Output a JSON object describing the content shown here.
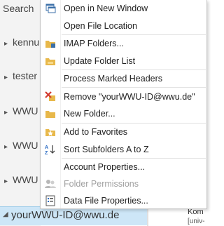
{
  "folder_pane": {
    "items": [
      {
        "label": "Search",
        "expanded": false
      },
      {
        "label": "kennu",
        "expanded": false
      },
      {
        "label": "tester",
        "expanded": false
      },
      {
        "label": "WWU",
        "expanded": false
      },
      {
        "label": "WWU",
        "expanded": false
      },
      {
        "label": "WWU",
        "expanded": false
      }
    ],
    "account": "yourWWU-ID@wwu.de",
    "right_snippet_1": "Kom",
    "right_snippet_2": "[univ-"
  },
  "context_menu": {
    "items": [
      {
        "label": "Open in New Window",
        "icon": "new-window-icon",
        "enabled": true
      },
      {
        "label": "Open File Location",
        "icon": "",
        "enabled": true
      },
      {
        "label": "IMAP Folders...",
        "icon": "imap-folders-icon",
        "enabled": true
      },
      {
        "label": "Update Folder List",
        "icon": "update-folder-list-icon",
        "enabled": true
      },
      {
        "label": "Process Marked Headers",
        "icon": "",
        "enabled": true
      },
      {
        "label": "Remove \"yourWWU-ID@wwu.de\"",
        "icon": "remove-account-icon",
        "enabled": true
      },
      {
        "label": "New Folder...",
        "icon": "new-folder-icon",
        "enabled": true
      },
      {
        "label": "Add to Favorites",
        "icon": "favorites-star-icon",
        "enabled": true
      },
      {
        "label": "Sort Subfolders A to Z",
        "icon": "sort-az-icon",
        "enabled": true
      },
      {
        "label": "Account Properties...",
        "icon": "",
        "enabled": true
      },
      {
        "label": "Folder Permissions",
        "icon": "folder-permissions-icon",
        "enabled": false
      },
      {
        "label": "Data File Properties...",
        "icon": "data-file-properties-icon",
        "enabled": true
      }
    ]
  },
  "colors": {
    "account_highlight": "#cde6f7",
    "folder_icon": "#e8b84a",
    "remove_icon": "#d23a2f",
    "sort_icon": "#2b6cc4"
  }
}
